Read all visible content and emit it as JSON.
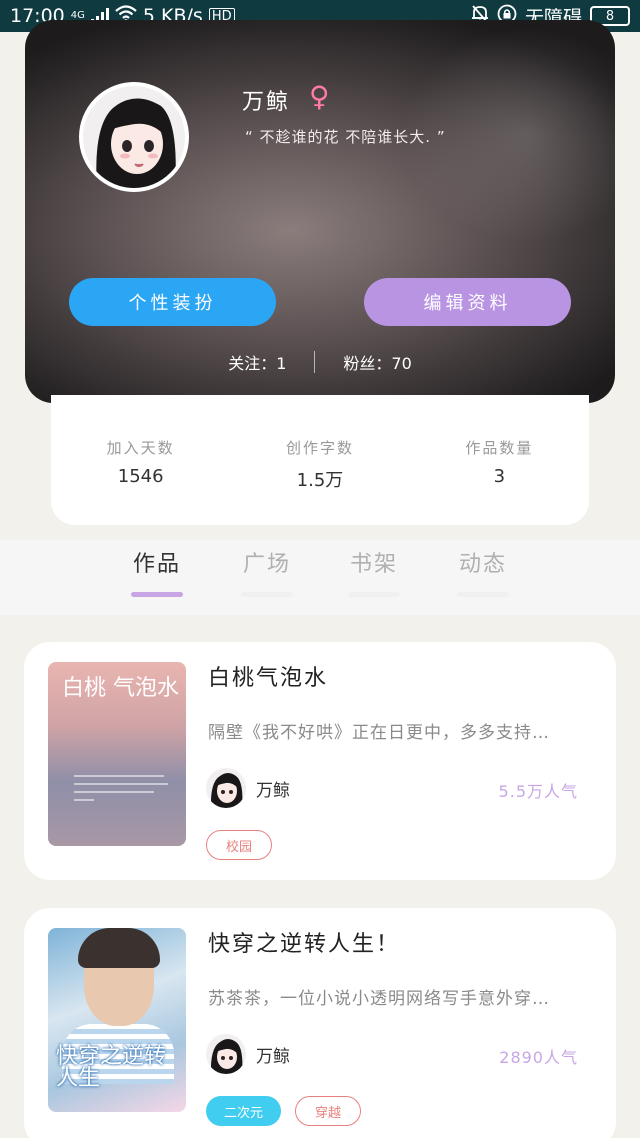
{
  "status_bar": {
    "time": "17:00",
    "network": "4G",
    "speed": "5 KB/s",
    "hd": "HD",
    "accessibility_text": "无障碍",
    "battery": "8"
  },
  "profile": {
    "username": "万鲸",
    "gender_symbol": "♀",
    "motto": "“ 不趁谁的花 不陪谁长大. ”",
    "buttons": {
      "dress_up": "个性装扮",
      "edit_profile": "编辑资料"
    },
    "following": "关注：1",
    "followers": "粉丝：70"
  },
  "stats": [
    {
      "label": "加入天数",
      "value": "1546"
    },
    {
      "label": "创作字数",
      "value": "1.5万"
    },
    {
      "label": "作品数量",
      "value": "3"
    }
  ],
  "tabs": [
    {
      "label": "作品",
      "active": true
    },
    {
      "label": "广场",
      "active": false
    },
    {
      "label": "书架",
      "active": false
    },
    {
      "label": "动态",
      "active": false
    }
  ],
  "books": [
    {
      "title": "白桃气泡水",
      "description": "隔壁《我不好哄》正在日更中，多多支持…",
      "author": "万鲸",
      "popularity": "5.5万人气",
      "tags": [
        {
          "label": "校园",
          "style": "outline"
        }
      ],
      "cover_title": "白桃 气泡水"
    },
    {
      "title": "快穿之逆转人生！",
      "description": "苏茶茶，一位小说小透明网络写手意外穿…",
      "author": "万鲸",
      "popularity": "2890人气",
      "tags": [
        {
          "label": "二次元",
          "style": "fill"
        },
        {
          "label": "穿越",
          "style": "outline"
        }
      ],
      "cover_title": "快穿之逆转人生"
    }
  ],
  "colors": {
    "status_bar": "#0f3a40",
    "dress_button": "#2aa6f5",
    "edit_button": "#b894e3",
    "accent": "#c8a6e6",
    "tag_outline": "#e8827f",
    "tag_fill": "#41cdf0"
  }
}
